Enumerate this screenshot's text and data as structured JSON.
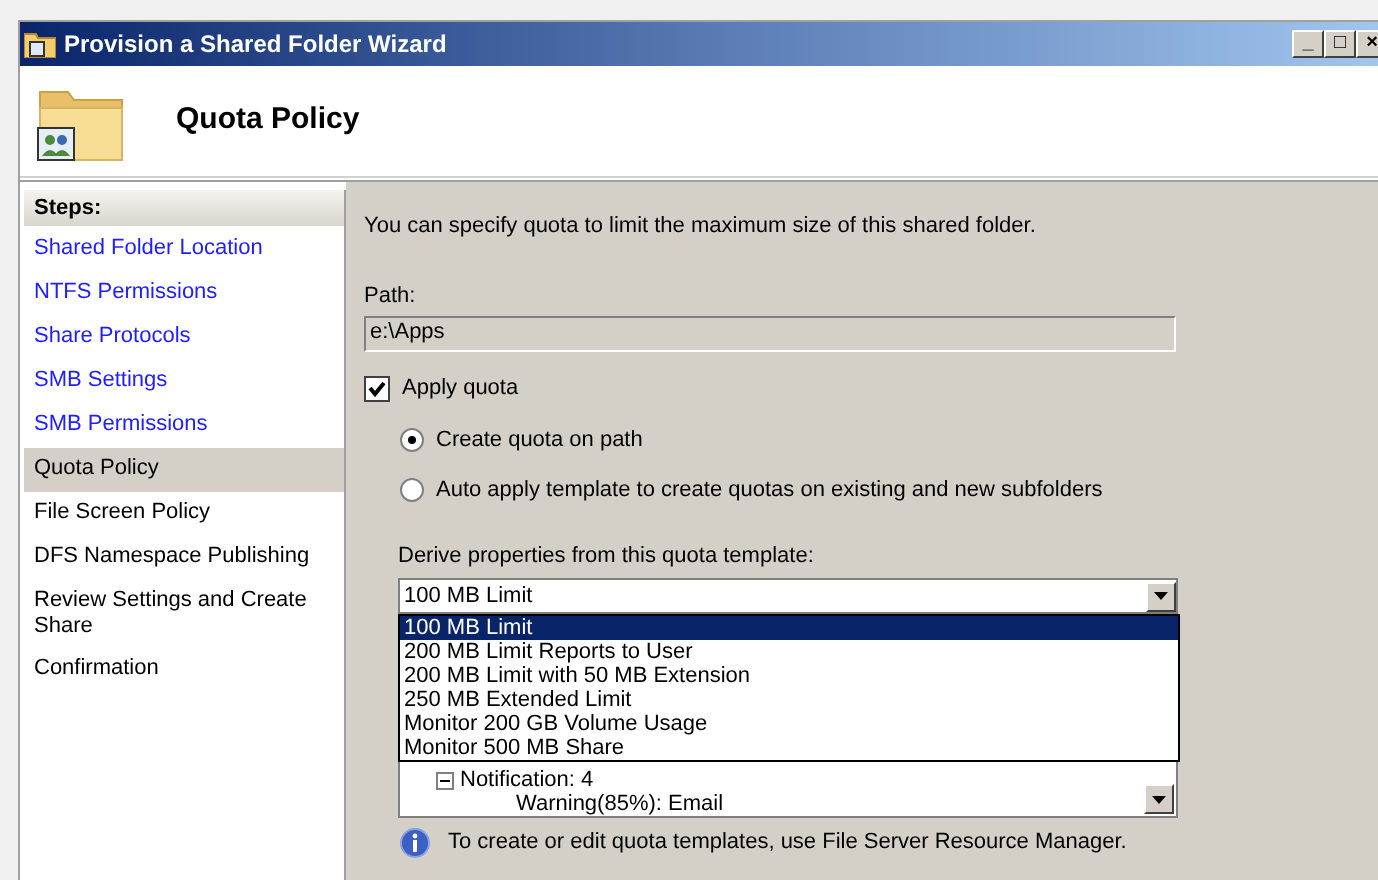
{
  "window": {
    "title": "Provision a Shared Folder Wizard",
    "controls": [
      "_",
      "□",
      "×"
    ]
  },
  "header": {
    "title": "Quota Policy"
  },
  "steps": {
    "heading": "Steps:",
    "items": [
      {
        "label": "Shared Folder Location",
        "selected": false,
        "done": true
      },
      {
        "label": "NTFS Permissions",
        "selected": false,
        "done": true
      },
      {
        "label": "Share Protocols",
        "selected": false,
        "done": true
      },
      {
        "label": "SMB Settings",
        "selected": false,
        "done": true
      },
      {
        "label": "SMB Permissions",
        "selected": false,
        "done": true
      },
      {
        "label": "Quota Policy",
        "selected": true,
        "done": false
      },
      {
        "label": "File Screen Policy",
        "selected": false,
        "done": false
      },
      {
        "label": "DFS Namespace Publishing",
        "selected": false,
        "done": false
      },
      {
        "label": "Review Settings and Create Share",
        "selected": false,
        "done": false
      },
      {
        "label": "Confirmation",
        "selected": false,
        "done": false
      }
    ]
  },
  "content": {
    "intro": "You can specify quota to limit the maximum size of this shared folder.",
    "path_label": "Path:",
    "path_value": "e:\\Apps",
    "apply_quota": {
      "label": "Apply quota",
      "checked": true
    },
    "options": [
      {
        "label": "Create quota on path",
        "selected": true
      },
      {
        "label": "Auto apply template to create quotas on existing and new subfolders",
        "selected": false
      }
    ],
    "template_label": "Derive properties from this quota template:",
    "template_value": "100 MB Limit",
    "template_list": [
      {
        "label": "100 MB Limit",
        "selected": true
      },
      {
        "label": "200 MB Limit Reports to User",
        "selected": false
      },
      {
        "label": "200 MB Limit with 50 MB Extension",
        "selected": false
      },
      {
        "label": "250 MB Extended Limit",
        "selected": false
      },
      {
        "label": "Monitor 200 GB Volume Usage",
        "selected": false
      },
      {
        "label": "Monitor 500 MB Share",
        "selected": false
      }
    ],
    "summary_tree": [
      {
        "label": "Notification: 4",
        "expanded": true,
        "children": [
          {
            "label": "Warning(85%): Email"
          }
        ]
      }
    ],
    "info": "To create or edit quota templates, use File Server Resource Manager."
  }
}
